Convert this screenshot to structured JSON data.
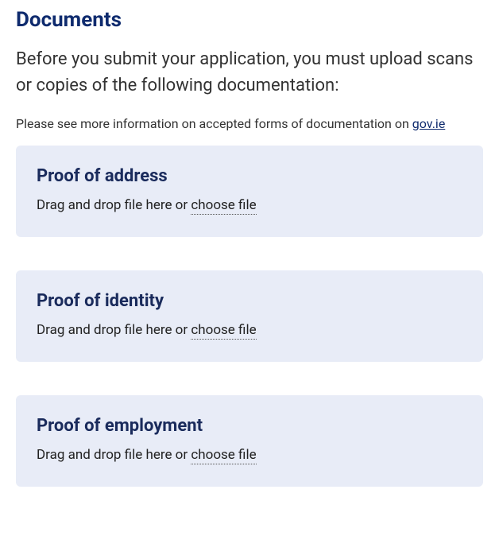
{
  "heading": "Documents",
  "intro": "Before you submit your application, you must upload scans or copies of the following documentation:",
  "info_prefix": "Please see more information on accepted forms of documentation on ",
  "info_link_text": "gov.ie",
  "uploads": [
    {
      "title": "Proof of address",
      "instruction_prefix": "Drag and drop file here or ",
      "choose_label": "choose file"
    },
    {
      "title": "Proof of identity",
      "instruction_prefix": "Drag and drop file here or ",
      "choose_label": "choose file"
    },
    {
      "title": "Proof of employment",
      "instruction_prefix": "Drag and drop file here or ",
      "choose_label": "choose file"
    }
  ]
}
